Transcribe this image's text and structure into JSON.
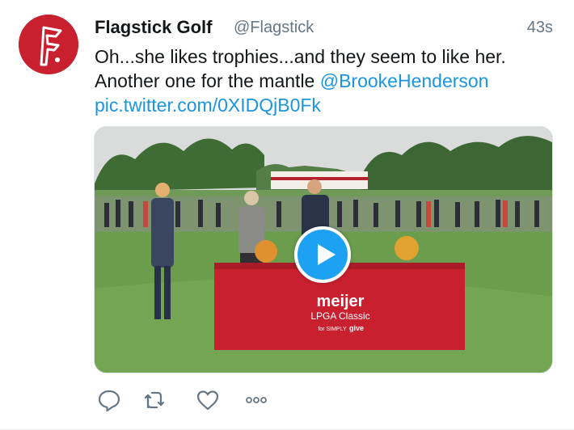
{
  "tweet": {
    "author_name": "Flagstick Golf",
    "author_handle": "@Flagstick",
    "timestamp": "43s",
    "text_line1": "Oh...she likes trophies...and they seem to like her.",
    "text_line2_prefix": "Another one for the mantle ",
    "mention": "@BrookeHenderson",
    "media_link": "pic.twitter.com/0XIDQjB0Fk"
  },
  "media": {
    "type": "video",
    "banner_brand": "meijer",
    "banner_event": "LPGA Classic",
    "banner_sponsor_prefix": "for SIMPLY",
    "banner_sponsor": "give"
  },
  "actions": {
    "icons": [
      "reply-icon",
      "retweet-icon",
      "like-icon",
      "more-icon"
    ]
  },
  "colors": {
    "link": "#1b95e0",
    "avatar_bg": "#c8202f",
    "play_button": "#1da1f2",
    "table_cloth": "#c8202f"
  }
}
